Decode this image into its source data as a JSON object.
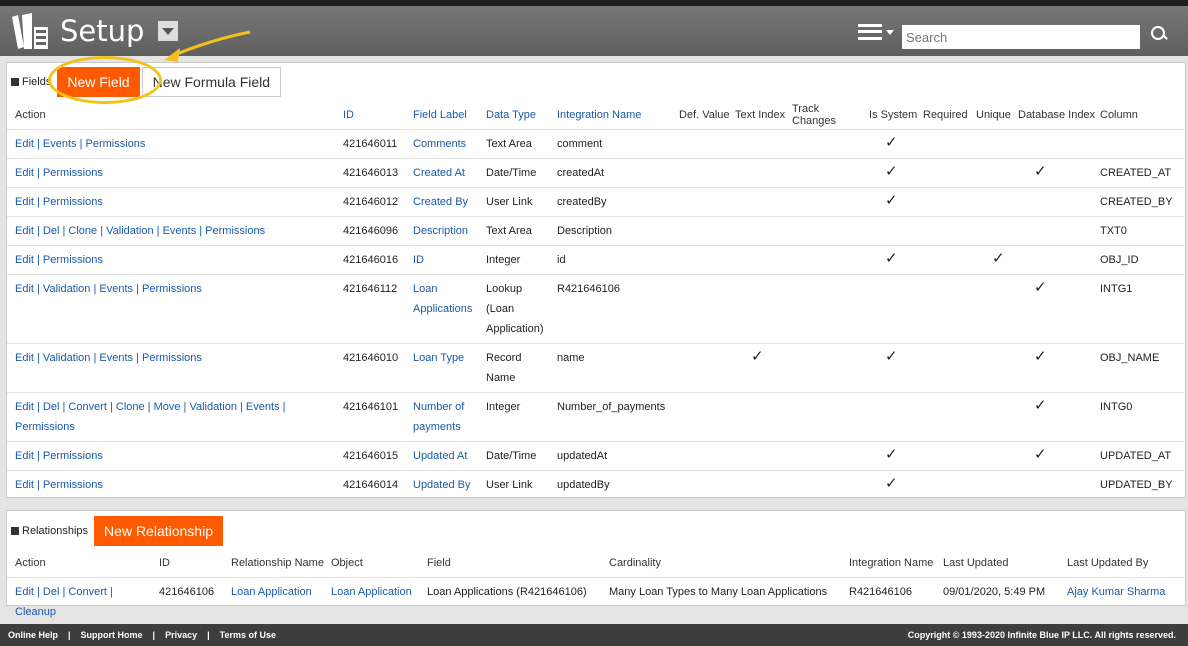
{
  "header": {
    "title": "Setup",
    "search_placeholder": "Search"
  },
  "fields": {
    "section_label": "Fields",
    "new_field": "New Field",
    "new_formula_field": "New Formula Field",
    "columns": [
      "Action",
      "ID",
      "Field Label",
      "Data Type",
      "Integration Name",
      "Def. Value",
      "Text Index",
      "Track Changes",
      "Is System",
      "Required",
      "Unique",
      "Database Index",
      "Column"
    ],
    "rows": [
      {
        "action": "Edit | Events | Permissions",
        "id": "421646011",
        "label": "Comments",
        "type": "Text Area",
        "integration": "comment",
        "text_index": "",
        "is_system": "✓",
        "unique": "",
        "db_index": "",
        "column": ""
      },
      {
        "action": "Edit | Permissions",
        "id": "421646013",
        "label": "Created At",
        "type": "Date/Time",
        "integration": "createdAt",
        "text_index": "",
        "is_system": "✓",
        "unique": "",
        "db_index": "✓",
        "column": "CREATED_AT"
      },
      {
        "action": "Edit | Permissions",
        "id": "421646012",
        "label": "Created By",
        "type": "User Link",
        "integration": "createdBy",
        "text_index": "",
        "is_system": "✓",
        "unique": "",
        "db_index": "",
        "column": "CREATED_BY"
      },
      {
        "action": "Edit | Del | Clone | Validation | Events | Permissions",
        "id": "421646096",
        "label": "Description",
        "type": "Text Area",
        "integration": "Description",
        "text_index": "",
        "is_system": "",
        "unique": "",
        "db_index": "",
        "column": "TXT0"
      },
      {
        "action": "Edit | Permissions",
        "id": "421646016",
        "label": "ID",
        "type": "Integer",
        "integration": "id",
        "text_index": "",
        "is_system": "✓",
        "unique": "✓",
        "db_index": "",
        "column": "OBJ_ID"
      },
      {
        "action": "Edit | Validation | Events | Permissions",
        "id": "421646112",
        "label": "Loan Applications",
        "type": "Lookup (Loan Application)",
        "integration": "R421646106",
        "text_index": "",
        "is_system": "",
        "unique": "",
        "db_index": "✓",
        "column": "INTG1"
      },
      {
        "action": "Edit | Validation | Events | Permissions",
        "id": "421646010",
        "label": "Loan Type",
        "type": "Record Name",
        "integration": "name",
        "text_index": "✓",
        "is_system": "✓",
        "unique": "",
        "db_index": "✓",
        "column": "OBJ_NAME"
      },
      {
        "action": "Edit | Del | Convert | Clone | Move | Validation | Events | Permissions",
        "id": "421646101",
        "label": "Number of payments",
        "type": "Integer",
        "integration": "Number_of_payments",
        "text_index": "",
        "is_system": "",
        "unique": "",
        "db_index": "✓",
        "column": "INTG0"
      },
      {
        "action": "Edit | Permissions",
        "id": "421646015",
        "label": "Updated At",
        "type": "Date/Time",
        "integration": "updatedAt",
        "text_index": "",
        "is_system": "✓",
        "unique": "",
        "db_index": "✓",
        "column": "UPDATED_AT"
      },
      {
        "action": "Edit | Permissions",
        "id": "421646014",
        "label": "Updated By",
        "type": "User Link",
        "integration": "updatedBy",
        "text_index": "",
        "is_system": "✓",
        "unique": "",
        "db_index": "",
        "column": "UPDATED_BY"
      }
    ]
  },
  "relationships": {
    "section_label": "Relationships",
    "new_relationship": "New Relationship",
    "columns": [
      "Action",
      "ID",
      "Relationship Name",
      "Object",
      "Field",
      "Cardinality",
      "Integration Name",
      "Last Updated",
      "Last Updated By"
    ],
    "rows": [
      {
        "action": "Edit | Del | Convert | Cleanup",
        "id": "421646106",
        "name": "Loan Application",
        "object": "Loan Application",
        "field": "Loan Applications (R421646106)",
        "cardinality": "Many Loan Types to Many Loan Applications",
        "integration": "R421646106",
        "last_updated": "09/01/2020, 5:49 PM",
        "last_updated_by": "Ajay Kumar Sharma"
      }
    ]
  },
  "footer": {
    "links": [
      "Online Help",
      "Support Home",
      "Privacy",
      "Terms of Use"
    ],
    "separator": "|",
    "copyright": "Copyright © 1993-2020 Infinite Blue IP LLC. All rights reserved."
  },
  "colors": {
    "accent": "#ff5a00",
    "link": "#1a5aa7",
    "highlight": "#f2c21b",
    "header": "#666666"
  }
}
